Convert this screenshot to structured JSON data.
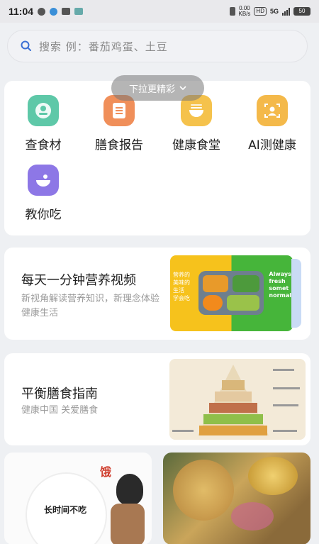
{
  "status_bar": {
    "time": "11:04",
    "net_speed": "0.00\nKB/s",
    "hd": "HD",
    "signal": "5G",
    "battery": "50"
  },
  "search": {
    "placeholder": "搜索 例：番茄鸡蛋、土豆"
  },
  "pull_tip": {
    "label": "下拉更精彩"
  },
  "menu": [
    {
      "label": "查食材",
      "icon": "ingredient-icon",
      "color": "#5ec8a8"
    },
    {
      "label": "膳食报告",
      "icon": "report-icon",
      "color": "#f08f5a"
    },
    {
      "label": "健康食堂",
      "icon": "bowl-icon",
      "color": "#f5c24c"
    },
    {
      "label": "AI测健康",
      "icon": "face-scan-icon",
      "color": "#f4b94a"
    },
    {
      "label": "教你吃",
      "icon": "dish-icon",
      "color": "#8d77e6"
    }
  ],
  "cards": [
    {
      "title": "每天一分钟营养视频",
      "subtitle": "新视角解读营养知识，新理念体验健康生活",
      "thumb_text_left": "营养的\n美味的\n生活\n学会吃",
      "thumb_text_right": "Always\nfresh\nsomet\nnormal"
    },
    {
      "title": "平衡膳食指南",
      "subtitle": "健康中国 关爱膳食"
    }
  ],
  "bottom": {
    "left_label": "长时间不吃",
    "left_tag": "饿"
  }
}
